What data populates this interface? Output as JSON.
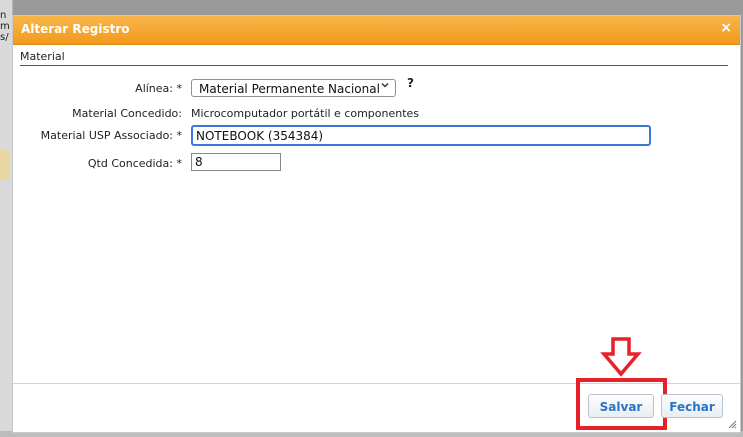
{
  "background": {
    "fragments": [
      "n",
      "m",
      "s/"
    ]
  },
  "dialog": {
    "title": "Alterar Registro",
    "close_glyph": "×",
    "section_title": "Material",
    "fields": {
      "alinea": {
        "label": "Alínea: *",
        "selected": "Material Permanente Nacional",
        "help": "?"
      },
      "material_concedido": {
        "label": "Material Concedido:",
        "value": "Microcomputador portátil e componentes"
      },
      "material_usp": {
        "label": "Material USP Associado: *",
        "value": "NOTEBOOK (354384)"
      },
      "qtd": {
        "label": "Qtd Concedida: *",
        "value": "8"
      }
    },
    "buttons": {
      "salvar": "Salvar",
      "fechar": "Fechar"
    }
  },
  "colors": {
    "titlebar": "#f29a1c",
    "accent_blue": "#2a74c4",
    "annotation_red": "#e8202a"
  }
}
